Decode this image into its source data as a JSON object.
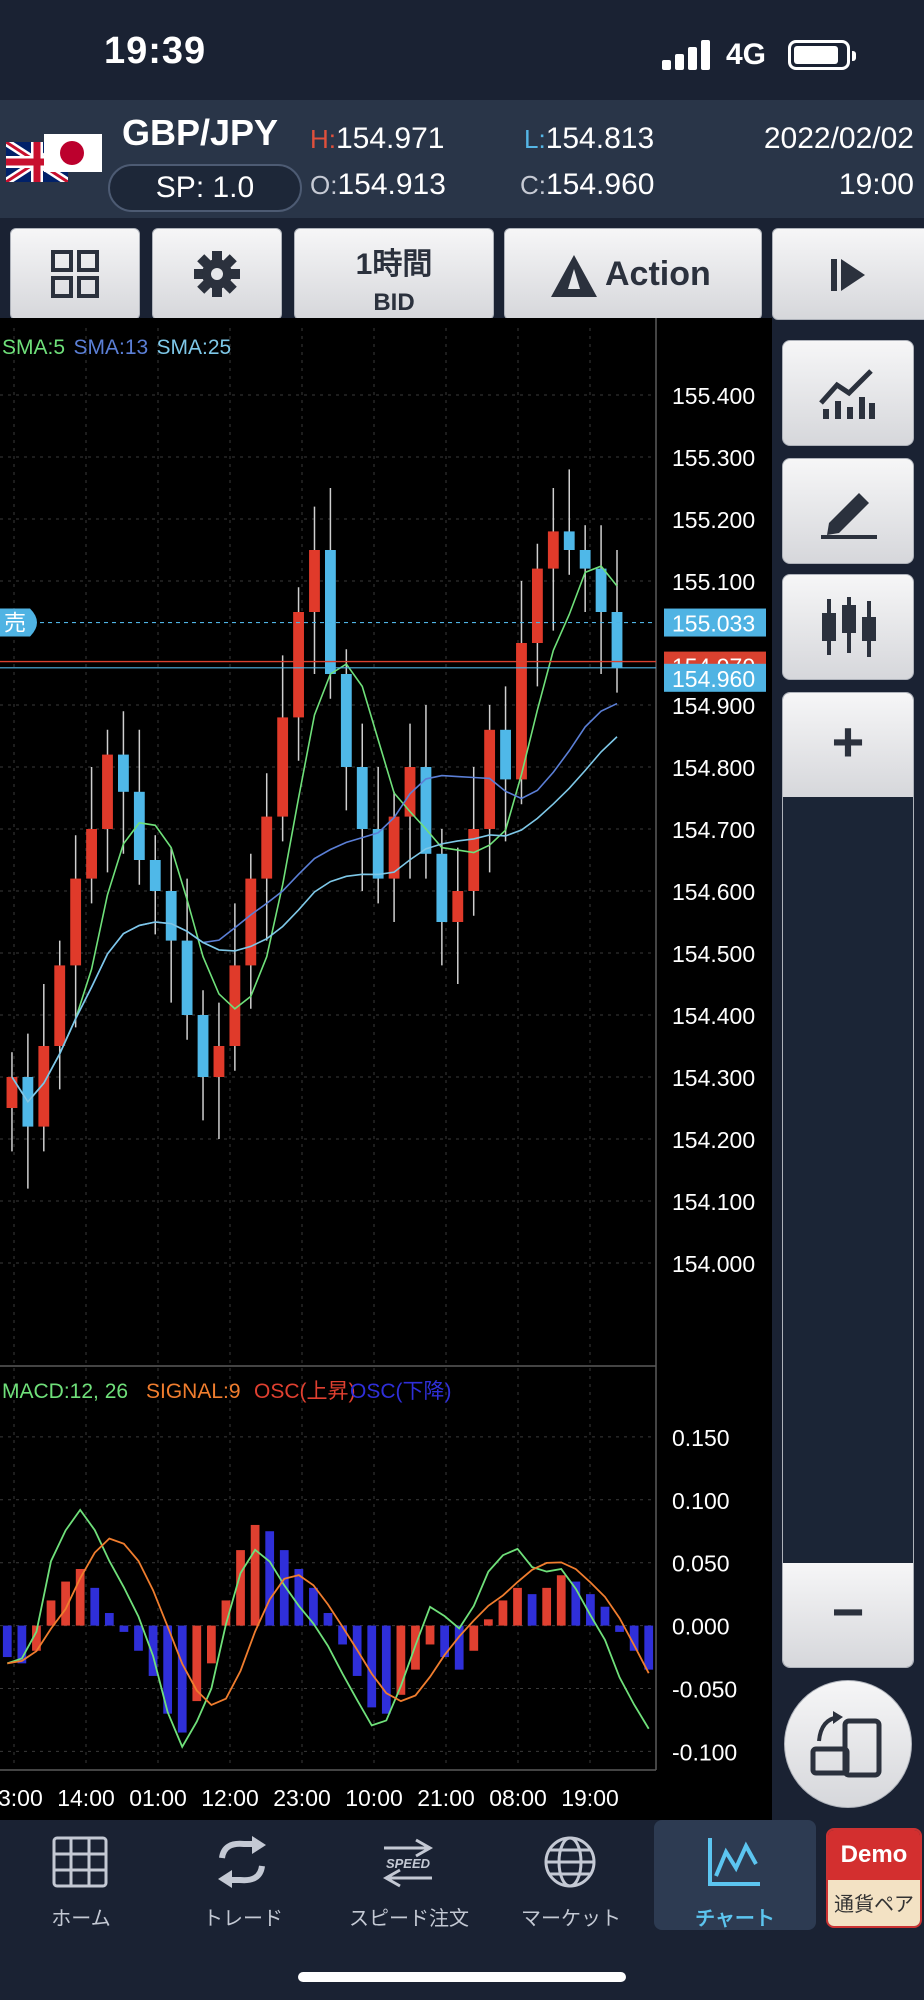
{
  "status": {
    "time": "19:39",
    "network": "4G"
  },
  "header": {
    "pair": "GBP/JPY",
    "spread": "SP: 1.0",
    "high_key": "H:",
    "high": "154.971",
    "low_key": "L:",
    "low": "154.813",
    "open_key": "O:",
    "open": "154.913",
    "close_key": "C:",
    "close": "154.960",
    "date": "2022/02/02",
    "time": "19:00"
  },
  "toolbar": {
    "timeframe": "1時間",
    "price_type": "BID",
    "action": "Action"
  },
  "chart": {
    "indicators": [
      {
        "label": "SMA:5",
        "color": "#6fe07a"
      },
      {
        "label": "SMA:13",
        "color": "#5b7fd6"
      },
      {
        "label": "SMA:25",
        "color": "#7ec8e8"
      }
    ],
    "sell_marker": "売",
    "price_labels": {
      "ask": "155.033",
      "ask_color": "#4fb3e3",
      "current": "154.970",
      "current_color": "#d9412f",
      "bid": "154.960",
      "bid_color": "#4fb3e3"
    },
    "y_ticks": [
      "155.400",
      "155.300",
      "155.200",
      "155.100",
      "154.900",
      "154.800",
      "154.700",
      "154.600",
      "154.500",
      "154.400",
      "154.300",
      "154.200",
      "154.100",
      "154.000"
    ],
    "macd_legend": [
      {
        "label": "MACD:12, 26",
        "color": "#6fe07a"
      },
      {
        "label": "SIGNAL:9",
        "color": "#f07d2e"
      },
      {
        "label": "OSC(上昇)",
        "color": "#e04030"
      },
      {
        "label": "OSC(下降)",
        "color": "#2f2fd9"
      }
    ],
    "macd_ticks": [
      "0.150",
      "0.100",
      "0.050",
      "0.000",
      "-0.050",
      "-0.100"
    ],
    "x_ticks": [
      "3:00",
      "14:00",
      "01:00",
      "12:00",
      "23:00",
      "10:00",
      "21:00",
      "08:00",
      "19:00"
    ]
  },
  "chart_data": [
    {
      "type": "candlestick",
      "title": "GBP/JPY 1時間 BID",
      "ylim": [
        154.0,
        155.4
      ],
      "x_ticks": [
        "3:00",
        "14:00",
        "01:00",
        "12:00",
        "23:00",
        "10:00",
        "21:00",
        "08:00",
        "19:00"
      ],
      "ohlc": {
        "open": 154.913,
        "high": 154.971,
        "low": 154.813,
        "close": 154.96
      },
      "series": [
        {
          "name": "SMA:5"
        },
        {
          "name": "SMA:13"
        },
        {
          "name": "SMA:25"
        }
      ],
      "closes": [
        154.3,
        154.22,
        154.35,
        154.48,
        154.62,
        154.7,
        154.82,
        154.76,
        154.65,
        154.6,
        154.52,
        154.4,
        154.3,
        154.35,
        154.48,
        154.62,
        154.72,
        154.88,
        155.05,
        155.15,
        154.95,
        154.8,
        154.7,
        154.62,
        154.72,
        154.8,
        154.66,
        154.55,
        154.6,
        154.7,
        154.86,
        154.78,
        155.0,
        155.12,
        155.18,
        155.15,
        155.12,
        155.05,
        154.96
      ]
    },
    {
      "type": "bar",
      "title": "MACD",
      "ylim": [
        -0.1,
        0.15
      ],
      "series": [
        {
          "name": "MACD:12, 26"
        },
        {
          "name": "SIGNAL:9"
        },
        {
          "name": "OSC(上昇)"
        },
        {
          "name": "OSC(下降)"
        }
      ],
      "osc": [
        -0.025,
        -0.03,
        -0.02,
        0.02,
        0.035,
        0.045,
        0.03,
        0.01,
        -0.005,
        -0.02,
        -0.04,
        -0.07,
        -0.085,
        -0.06,
        -0.03,
        0.02,
        0.06,
        0.08,
        0.075,
        0.06,
        0.045,
        0.03,
        0.01,
        -0.015,
        -0.04,
        -0.065,
        -0.07,
        -0.055,
        -0.035,
        -0.015,
        -0.025,
        -0.035,
        -0.02,
        0.005,
        0.02,
        0.03,
        0.025,
        0.03,
        0.04,
        0.035,
        0.025,
        0.015,
        -0.005,
        -0.02,
        -0.035
      ]
    }
  ],
  "right_panel": {
    "plus": "+",
    "minus": "−"
  },
  "nav": [
    {
      "label": "ホーム"
    },
    {
      "label": "トレード"
    },
    {
      "label": "スピード注文",
      "icon_text": "SPEED"
    },
    {
      "label": "マーケット"
    },
    {
      "label": "チャート"
    }
  ],
  "demo": {
    "top": "Demo",
    "bottom": "通貨ペア"
  }
}
